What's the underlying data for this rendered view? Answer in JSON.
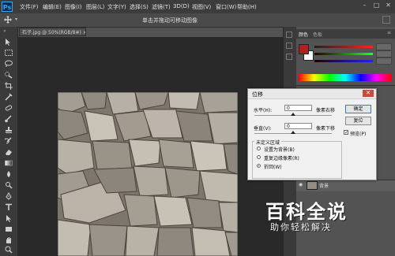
{
  "app": {
    "logo": "Ps",
    "menus": [
      "文件(F)",
      "编辑(E)",
      "图像(I)",
      "图层(L)",
      "文字(Y)",
      "选择(S)",
      "滤镜(T)",
      "3D(D)",
      "视图(V)",
      "窗口(W)",
      "帮助(H)"
    ],
    "window_controls": [
      "minimize-icon",
      "maximize-icon",
      "close-icon"
    ]
  },
  "options_bar": {
    "hint": "单击并拖动可移动图像"
  },
  "document": {
    "tab_title": "石子.jpg @ 50%(RGB/8#)",
    "zoom": "50%"
  },
  "panel": {
    "tabs": [
      "颜色",
      "色板"
    ],
    "fg_color": "#b32020",
    "bg_color": "#ffffff",
    "layer_name": "背景"
  },
  "dialog": {
    "title": "位移",
    "horizontal_label": "水平(H):",
    "horizontal_value": "0",
    "horizontal_hint": "像素右移",
    "vertical_label": "垂直(V):",
    "vertical_value": "0",
    "vertical_hint": "像素下移",
    "undefined_group": "未定义区域",
    "options": [
      "设置为背景(B)",
      "重复边缘像素(R)",
      "折回(W)"
    ],
    "selected_option": 2,
    "ok_label": "确定",
    "reset_label": "复位",
    "preview_label": "预览(P)",
    "preview_checked": true
  },
  "watermark": {
    "title": "百科全说",
    "subtitle": "助你轻松解决"
  }
}
